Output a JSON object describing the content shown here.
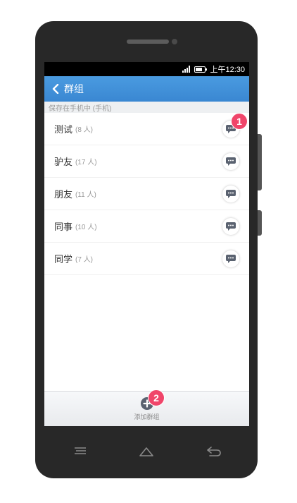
{
  "status_bar": {
    "time": "上午12:30"
  },
  "header": {
    "title": "群组"
  },
  "section": {
    "title": "保存在手机中 (手机)"
  },
  "groups": [
    {
      "name": "测试",
      "count": "(8 人)"
    },
    {
      "name": "驴友",
      "count": "(17 人)"
    },
    {
      "name": "朋友",
      "count": "(11 人)"
    },
    {
      "name": "同事",
      "count": "(10 人)"
    },
    {
      "name": "同学",
      "count": "(7 人)"
    }
  ],
  "bottom": {
    "add_label": "添加群组"
  },
  "badges": {
    "first": "1",
    "second": "2"
  },
  "icons": {
    "back": "chevron-left-icon",
    "chat": "chat-bubble-icon",
    "add": "plus-circle-icon",
    "menu": "menu-icon",
    "home": "home-icon",
    "nav_back": "back-arrow-icon"
  },
  "colors": {
    "header": "#3a87d2",
    "badge": "#f0456a",
    "icon": "#5a6270"
  }
}
